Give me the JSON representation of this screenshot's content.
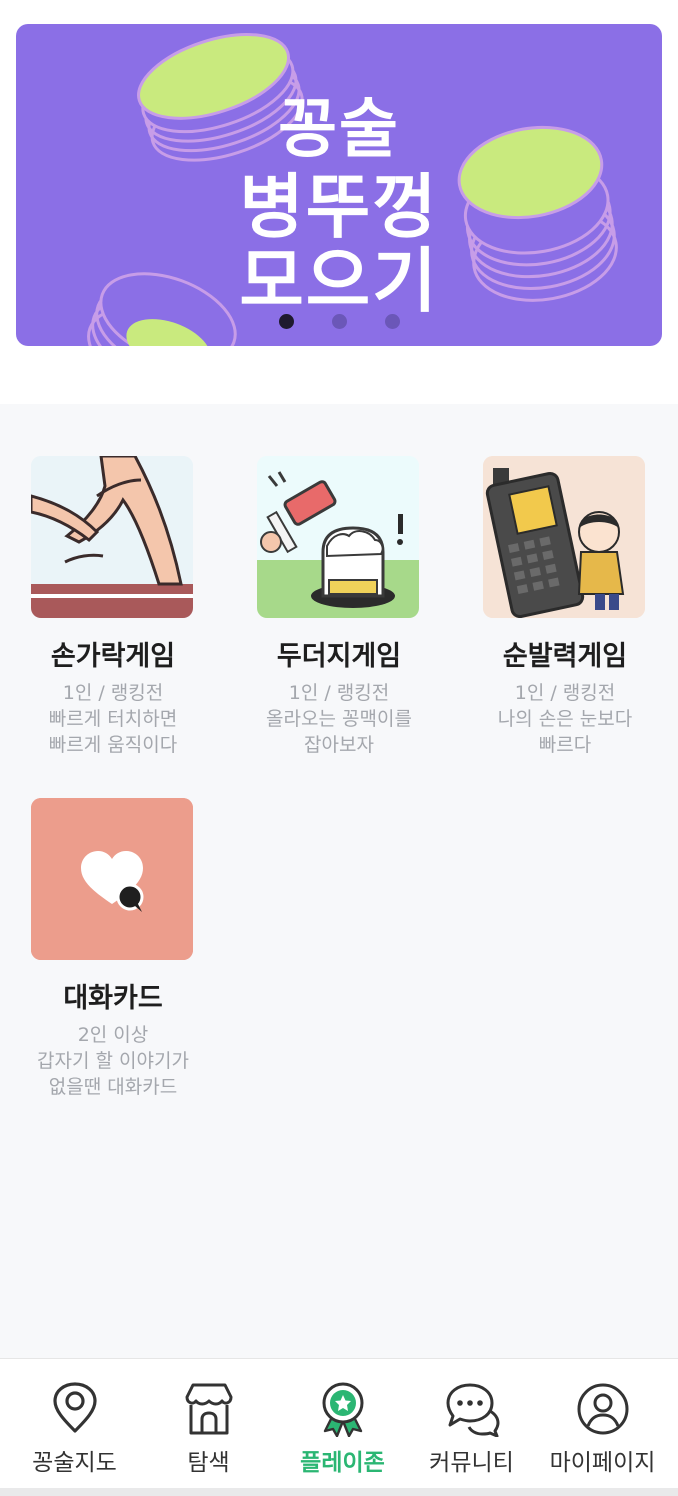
{
  "banner": {
    "title_line1": "꽁술",
    "title_line2": "병뚜껑",
    "title_line3": "모으기",
    "page_count": 3,
    "active_page": 1,
    "colors": {
      "background": "#8b6fe6",
      "coin": "#c9ea7e",
      "coin_rim": "#c79de8"
    }
  },
  "games": [
    {
      "title": "손가락게임",
      "players": "1인 / 랭킹전",
      "desc_line1": "빠르게 터치하면",
      "desc_line2": "빠르게 움직이다",
      "icon": "finger-run-icon"
    },
    {
      "title": "두더지게임",
      "players": "1인 / 랭킹전",
      "desc_line1": "올라오는 꽁맥이를",
      "desc_line2": "잡아보자",
      "icon": "mole-hammer-icon"
    },
    {
      "title": "순발력게임",
      "players": "1인 / 랭킹전",
      "desc_line1": "나의 손은 눈보다",
      "desc_line2": "빠르다",
      "icon": "phone-boy-icon"
    },
    {
      "title": "대화카드",
      "players": "2인 이상",
      "desc_line1": "갑자기 할 이야기가",
      "desc_line2": "없을땐 대화카드",
      "icon": "heart-chat-icon"
    }
  ],
  "tabbar": {
    "active": "플레이존",
    "active_color": "#2bb673",
    "items": [
      {
        "label": "꽁술지도",
        "icon": "map-pin-icon"
      },
      {
        "label": "탐색",
        "icon": "store-icon"
      },
      {
        "label": "플레이존",
        "icon": "badge-icon"
      },
      {
        "label": "커뮤니티",
        "icon": "chat-bubbles-icon"
      },
      {
        "label": "마이페이지",
        "icon": "user-icon"
      }
    ]
  }
}
